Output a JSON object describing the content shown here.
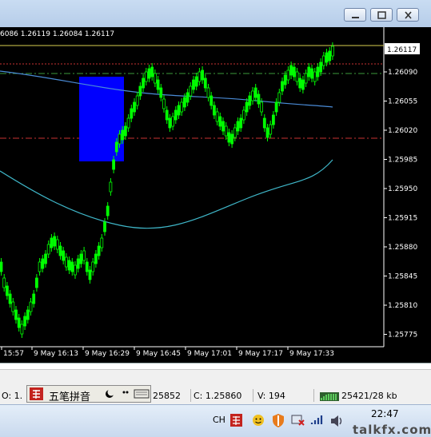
{
  "chart": {
    "ohlc_line": "6086 1.26119 1.26084 1.26117",
    "current_price": "1.26117",
    "price_levels": [
      "1.26090",
      "1.26055",
      "1.26020",
      "1.25985",
      "1.25950",
      "1.25915",
      "1.25880",
      "1.25845",
      "1.25810",
      "1.25775"
    ],
    "time_labels": [
      "15:57",
      "9 May 16:13",
      "9 May 16:29",
      "9 May 16:45",
      "9 May 17:01",
      "9 May 17:17",
      "9 May 17:33"
    ],
    "colors": {
      "background": "#000000",
      "candles": "#00ff00",
      "ma_fast": "#4a8bd6",
      "ma_slow": "#3fb7c9",
      "box": "#0000ff",
      "level_red": "#c83232",
      "level_green": "#3c9a3c",
      "level_yellow": "#d8d050"
    }
  },
  "status": {
    "open": "O: 1.",
    "high": "25852",
    "close": "C: 1.25860",
    "volume": "V: 194",
    "traffic": "25421/28 kb"
  },
  "ime": {
    "mode": "五笔拼音"
  },
  "taskbar": {
    "language": "CH",
    "time": "22:47",
    "watermark": "talkfx.com"
  },
  "icons": [
    "minimize-icon",
    "maximize-icon",
    "close-icon",
    "ime-logo-icon",
    "moon-icon",
    "punctuation-icon",
    "keyboard-icon",
    "connection-bars-icon",
    "signal-icon",
    "network-icon",
    "volume-icon",
    "shield-icon"
  ]
}
